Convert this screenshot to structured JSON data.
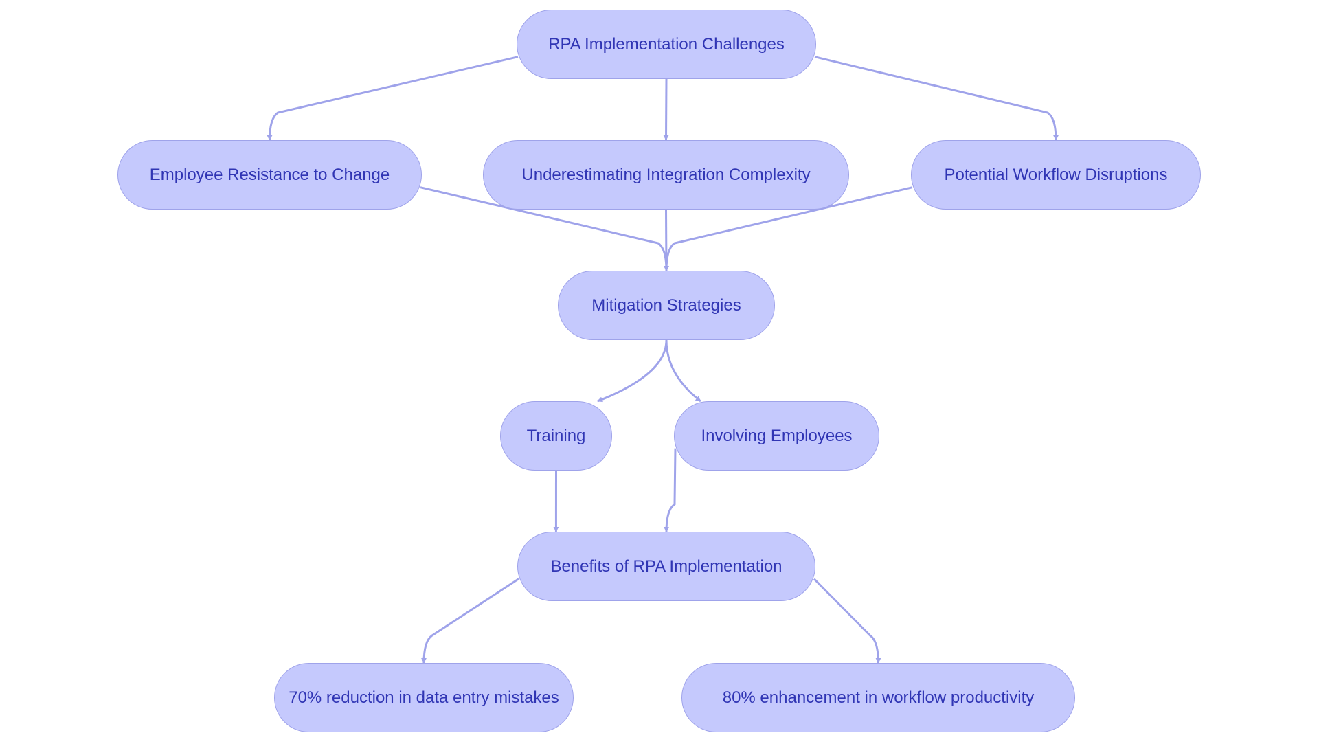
{
  "diagram": {
    "type": "flowchart",
    "colors": {
      "node_fill": "#c5c9fd",
      "node_border": "#9fa3ea",
      "text": "#3035b4",
      "edge": "#9fa3ea"
    },
    "nodes": [
      {
        "id": "challenges",
        "label": "RPA Implementation Challenges"
      },
      {
        "id": "resistance",
        "label": "Employee Resistance to Change"
      },
      {
        "id": "integration",
        "label": "Underestimating Integration Complexity"
      },
      {
        "id": "disruptions",
        "label": "Potential Workflow Disruptions"
      },
      {
        "id": "mitigation",
        "label": "Mitigation Strategies"
      },
      {
        "id": "training",
        "label": "Training"
      },
      {
        "id": "involving",
        "label": "Involving Employees"
      },
      {
        "id": "benefits",
        "label": "Benefits of RPA Implementation"
      },
      {
        "id": "reduction",
        "label": "70% reduction in data entry mistakes"
      },
      {
        "id": "enhancement",
        "label": "80% enhancement in workflow productivity"
      }
    ],
    "edges": [
      {
        "from": "challenges",
        "to": "resistance"
      },
      {
        "from": "challenges",
        "to": "integration"
      },
      {
        "from": "challenges",
        "to": "disruptions"
      },
      {
        "from": "resistance",
        "to": "mitigation"
      },
      {
        "from": "integration",
        "to": "mitigation"
      },
      {
        "from": "disruptions",
        "to": "mitigation"
      },
      {
        "from": "mitigation",
        "to": "training"
      },
      {
        "from": "mitigation",
        "to": "involving"
      },
      {
        "from": "training",
        "to": "benefits"
      },
      {
        "from": "involving",
        "to": "benefits"
      },
      {
        "from": "benefits",
        "to": "reduction"
      },
      {
        "from": "benefits",
        "to": "enhancement"
      }
    ]
  }
}
